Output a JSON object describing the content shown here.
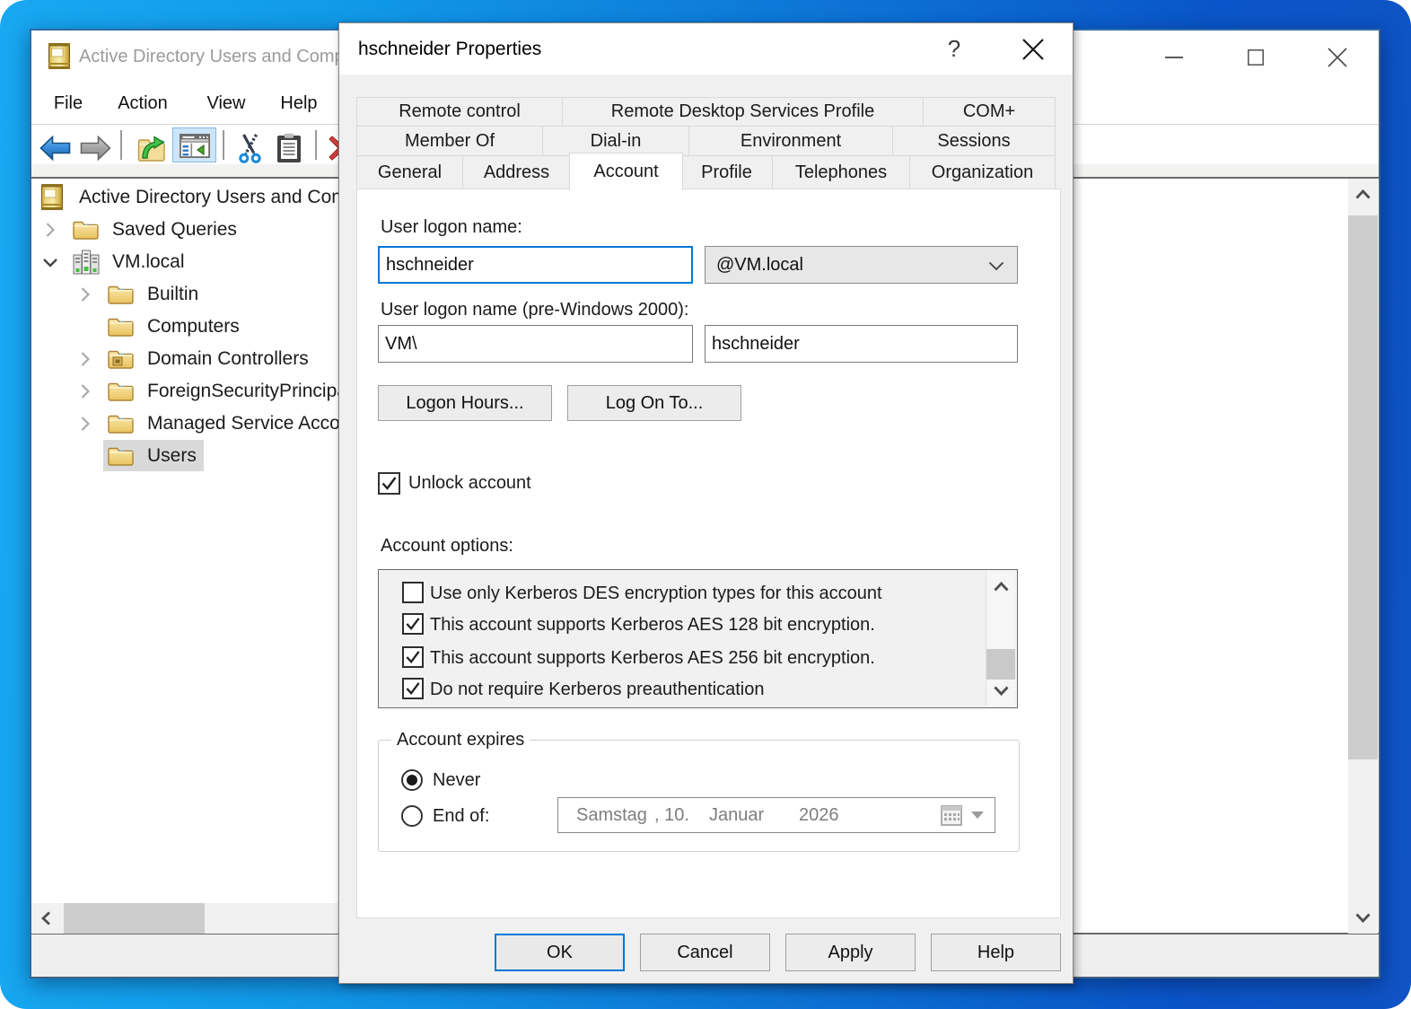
{
  "window": {
    "title": "Active Directory Users and Computers",
    "menu": [
      "File",
      "Action",
      "View",
      "Help"
    ],
    "toolbar_icons": [
      "back",
      "forward",
      "up-level",
      "console-tree-toggle",
      "cut",
      "paste",
      "delete"
    ],
    "tree": {
      "items": [
        {
          "label": "Active Directory Users and Computers"
        },
        {
          "label": "Saved Queries"
        },
        {
          "label": "VM.local"
        },
        {
          "label": "Builtin"
        },
        {
          "label": "Computers"
        },
        {
          "label": "Domain Controllers"
        },
        {
          "label": "ForeignSecurityPrincipals"
        },
        {
          "label": "Managed Service Accounts"
        },
        {
          "label": "Users"
        }
      ]
    }
  },
  "dialog": {
    "title": "hschneider Properties",
    "help_glyph": "?",
    "tab_rows": [
      {
        "tabs": [
          "Remote control",
          "Remote Desktop Services Profile",
          "COM+"
        ]
      },
      {
        "tabs": [
          "Member Of",
          "Dial-in",
          "Environment",
          "Sessions"
        ]
      },
      {
        "tabs": [
          "General",
          "Address",
          "Account",
          "Profile",
          "Telephones",
          "Organization"
        ]
      }
    ],
    "active_tab": "Account",
    "account": {
      "logon_label": "User logon name:",
      "logon_value": "hschneider",
      "domain_value": "@VM.local",
      "pre2000_label": "User logon name (pre-Windows 2000):",
      "pre2000_domain": "VM\\",
      "pre2000_value": "hschneider",
      "logon_hours_btn": "Logon Hours...",
      "log_on_to_btn": "Log On To...",
      "unlock_label": "Unlock account",
      "options_label": "Account options:",
      "options": [
        {
          "label": "Use only Kerberos DES encryption types for this account",
          "checked": false
        },
        {
          "label": "This account supports Kerberos AES 128 bit encryption.",
          "checked": true
        },
        {
          "label": "This account supports Kerberos AES 256 bit encryption.",
          "checked": true
        },
        {
          "label": "Do not require Kerberos preauthentication",
          "checked": true
        }
      ],
      "expires_label": "Account expires",
      "never_label": "Never",
      "end_of_label": "End of:",
      "date_value": [
        "Samstag",
        ", 10.",
        "Januar",
        "2026"
      ]
    },
    "buttons": [
      "OK",
      "Cancel",
      "Apply",
      "Help"
    ]
  }
}
